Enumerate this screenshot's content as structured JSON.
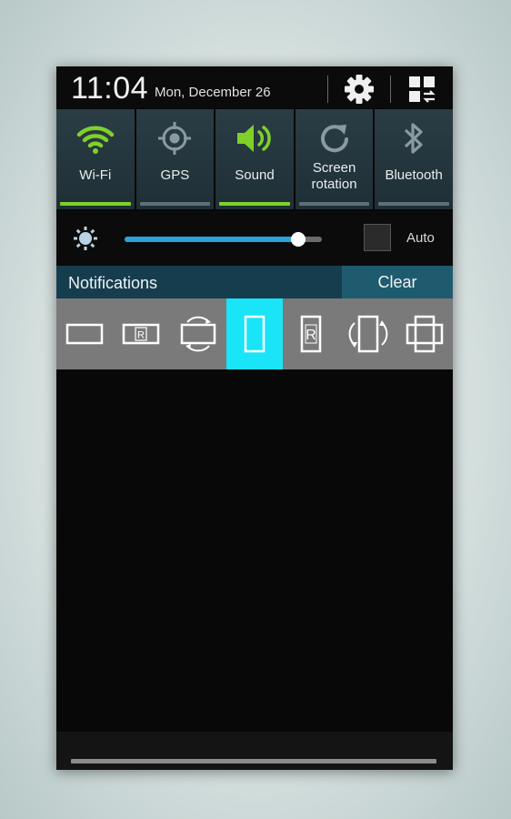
{
  "header": {
    "time": "11:04",
    "date": "Mon, December 26",
    "settings_icon": "gear-icon",
    "panel_icon": "quick-settings-grid-icon"
  },
  "toggles": [
    {
      "label": "Wi-Fi",
      "icon": "wifi-icon",
      "active": true
    },
    {
      "label": "GPS",
      "icon": "gps-icon",
      "active": false
    },
    {
      "label": "Sound",
      "icon": "speaker-icon",
      "active": true
    },
    {
      "label": "Screen rotation",
      "icon": "rotate-icon",
      "active": false
    },
    {
      "label": "Bluetooth",
      "icon": "bluetooth-icon",
      "active": false
    }
  ],
  "brightness": {
    "icon": "brightness-sun-icon",
    "level": 0.88,
    "auto_label": "Auto",
    "auto_checked": false
  },
  "notifications": {
    "title": "Notifications",
    "clear_label": "Clear"
  },
  "orientation_options": [
    {
      "icon": "landscape-icon",
      "selected": false
    },
    {
      "icon": "landscape-locked-icon",
      "selected": false
    },
    {
      "icon": "auto-rotate-landscape-icon",
      "selected": false
    },
    {
      "icon": "portrait-icon",
      "selected": true
    },
    {
      "icon": "portrait-locked-icon",
      "selected": false
    },
    {
      "icon": "auto-rotate-portrait-icon",
      "selected": false
    },
    {
      "icon": "full-sensor-icon",
      "selected": false
    }
  ],
  "colors": {
    "toggle_active": "#7fd12a",
    "toggle_inactive": "#5e6f77",
    "slider": "#2aa4d8",
    "selected_orientation": "#1ae4f7"
  }
}
